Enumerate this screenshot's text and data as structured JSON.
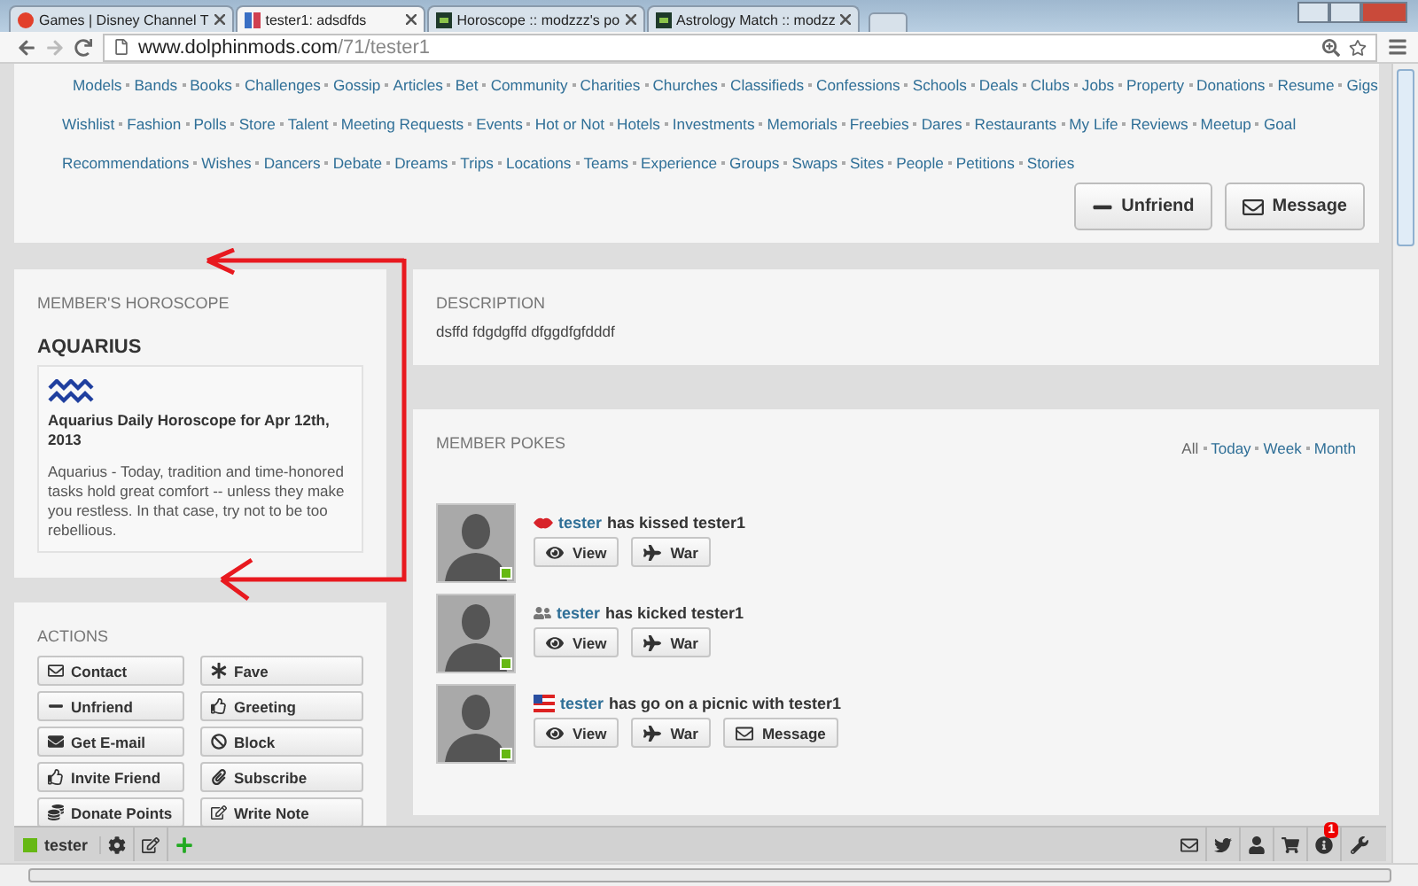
{
  "browser": {
    "tabs": [
      {
        "title": "Games | Disney Channel T",
        "selected": false,
        "kind": "disney"
      },
      {
        "title": "tester1: adsdfds",
        "selected": true,
        "kind": "site"
      },
      {
        "title": "Horoscope :: modzzz's po",
        "selected": false,
        "kind": "modzzz"
      },
      {
        "title": "Astrology Match :: modzz",
        "selected": false,
        "kind": "modzzz"
      }
    ],
    "address": {
      "host": "www.dolphinmods.com",
      "path": "/71/tester1"
    }
  },
  "nav_links": [
    [
      "Models",
      "Bands",
      "Books",
      "Challenges",
      "Gossip",
      "Articles",
      "Bet",
      "Community",
      "Charities",
      "Churches",
      "Classifieds",
      "Confessions",
      "Schools",
      "Deals",
      "Clubs",
      "Jobs",
      "Property",
      "Donations",
      "Resume",
      "Gigs"
    ],
    [
      "Wishlist",
      "Fashion",
      "Polls",
      "Store",
      "Talent",
      "Meeting Requests",
      "Events",
      "Hot or Not",
      "Hotels",
      "Investments",
      "Memorials",
      "Freebies",
      "Dares",
      "Restaurants",
      "My Life",
      "Reviews",
      "Meetup",
      "Goal"
    ],
    [
      "Recommendations",
      "Wishes",
      "Dancers",
      "Debate",
      "Dreams",
      "Trips",
      "Locations",
      "Teams",
      "Experience",
      "Groups",
      "Swaps",
      "Sites",
      "People",
      "Petitions",
      "Stories"
    ]
  ],
  "profile_buttons": [
    {
      "label": "Unfriend",
      "kind": "minus"
    },
    {
      "label": "Message",
      "kind": "mail"
    }
  ],
  "horoscope": {
    "heading": "MEMBER'S HOROSCOPE",
    "sign": "AQUARIUS",
    "title": "Aquarius Daily Horoscope for Apr 12th, 2013",
    "text": "Aquarius - Today, tradition and time-honored tasks hold great comfort -- unless they make you restless. In that case, try not to be too rebellious."
  },
  "actions": {
    "heading": "ACTIONS",
    "buttons": [
      {
        "label": "Contact",
        "kind": "mail"
      },
      {
        "label": "Fave",
        "kind": "asterisk"
      },
      {
        "label": "Unfriend",
        "kind": "minus"
      },
      {
        "label": "Greeting",
        "kind": "thumb"
      },
      {
        "label": "Get E-mail",
        "kind": "mail-solid"
      },
      {
        "label": "Block",
        "kind": "ban"
      },
      {
        "label": "Invite Friend",
        "kind": "thumb"
      },
      {
        "label": "Subscribe",
        "kind": "clip"
      },
      {
        "label": "Donate Points",
        "kind": "coins"
      },
      {
        "label": "Write Note",
        "kind": "edit"
      }
    ]
  },
  "description": {
    "heading": "DESCRIPTION",
    "text": "dsffd fdgdgffd dfggdfgfdddf"
  },
  "pokes": {
    "heading": "MEMBER POKES",
    "filters": [
      {
        "label": "All",
        "selected": true
      },
      {
        "label": "Today",
        "selected": false
      },
      {
        "label": "Week",
        "selected": false
      },
      {
        "label": "Month",
        "selected": false
      }
    ],
    "items": [
      {
        "kind": "kiss",
        "user": "tester",
        "action": "has kissed tester1",
        "online": true,
        "buttons": [
          {
            "label": "View",
            "kind": "eye"
          },
          {
            "label": "War",
            "kind": "plane"
          }
        ]
      },
      {
        "kind": "kick",
        "user": "tester",
        "action": "has kicked tester1",
        "online": true,
        "buttons": [
          {
            "label": "View",
            "kind": "eye"
          },
          {
            "label": "War",
            "kind": "plane"
          }
        ]
      },
      {
        "kind": "picnic",
        "user": "tester",
        "action": "has go on a picnic with tester1",
        "online": true,
        "buttons": [
          {
            "label": "View",
            "kind": "eye"
          },
          {
            "label": "War",
            "kind": "plane"
          },
          {
            "label": "Message",
            "kind": "mail"
          }
        ]
      }
    ]
  },
  "bottom_bar": {
    "user": "tester",
    "online": true,
    "notification_count": "1"
  }
}
